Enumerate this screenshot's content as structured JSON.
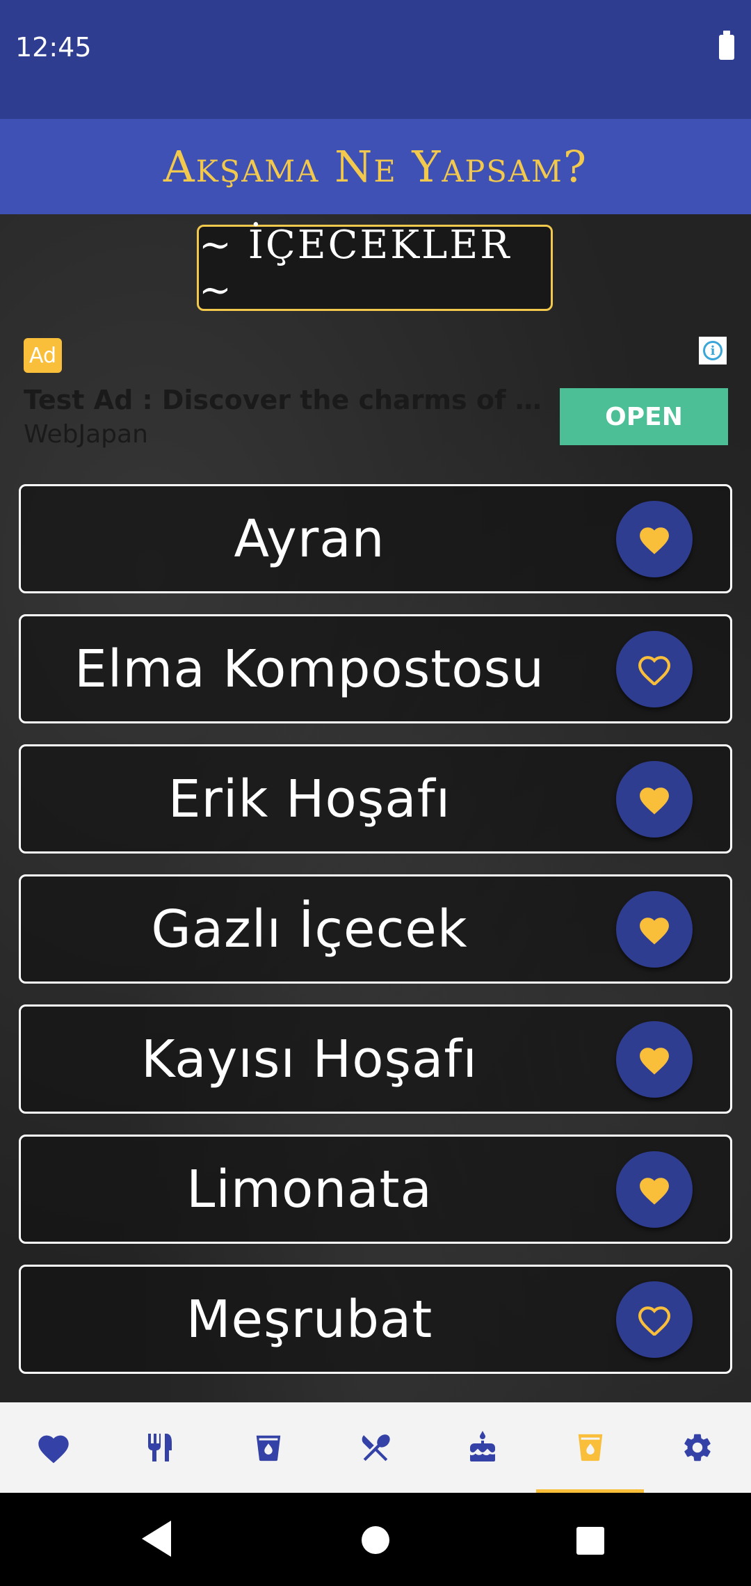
{
  "status_bar": {
    "time": "12:45"
  },
  "app_bar": {
    "title": "Akşama Ne Yapsam?"
  },
  "section": {
    "title": "~ İÇECEKLER ~"
  },
  "ad": {
    "badge": "Ad",
    "title": "Test Ad : Discover the charms of Ja...",
    "advertiser": "WebJapan",
    "button_label": "OPEN"
  },
  "drinks": [
    {
      "name": "Ayran",
      "favorite": true
    },
    {
      "name": "Elma Kompostosu",
      "favorite": false
    },
    {
      "name": "Erik Hoşafı",
      "favorite": true
    },
    {
      "name": "Gazlı İçecek",
      "favorite": true
    },
    {
      "name": "Kayısı Hoşafı",
      "favorite": true
    },
    {
      "name": "Limonata",
      "favorite": true
    },
    {
      "name": "Meşrubat",
      "favorite": false
    }
  ],
  "bottom_nav": {
    "items": [
      {
        "icon": "heart-icon",
        "active": false
      },
      {
        "icon": "fork-knife-icon",
        "active": false
      },
      {
        "icon": "soup-bowl-icon",
        "active": false
      },
      {
        "icon": "crossed-utensils-icon",
        "active": false
      },
      {
        "icon": "cake-icon",
        "active": false
      },
      {
        "icon": "drink-cup-icon",
        "active": true
      },
      {
        "icon": "gear-icon",
        "active": false
      }
    ]
  },
  "colors": {
    "primary_dark": "#2f3d91",
    "primary": "#3f51b5",
    "accent": "#f9bf3b",
    "title_gold": "#f2c94c",
    "ad_button": "#4cbf96",
    "nav_icon": "#3441a6"
  }
}
